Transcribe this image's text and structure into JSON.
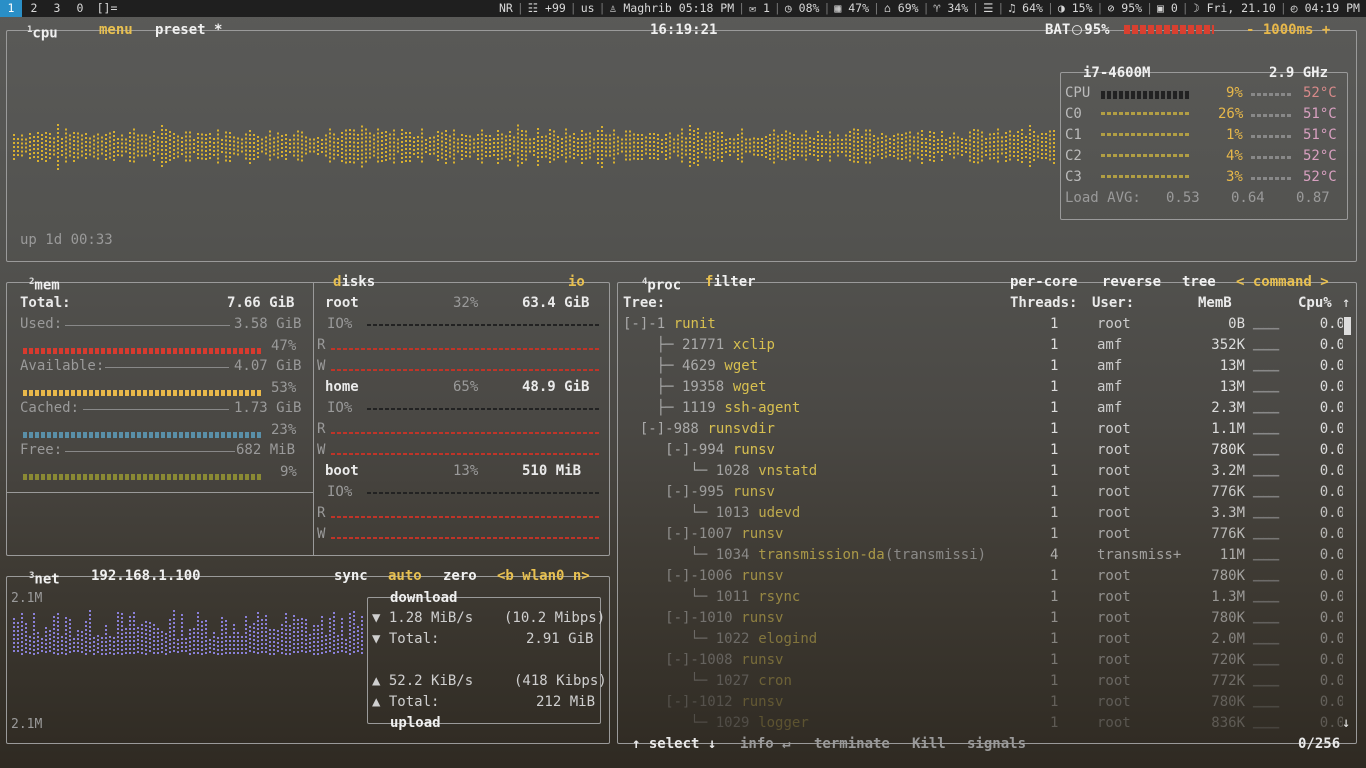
{
  "topbar": {
    "workspaces": [
      "1",
      "2",
      "3",
      "0",
      "[]="
    ],
    "active": 0,
    "status": [
      "NR",
      "|",
      "☷ +99",
      "|",
      "us",
      "|",
      "♙ Maghrib 05:18 PM",
      "|",
      "✉ 1",
      "|",
      "◷ 08%",
      "|",
      "▦ 47%",
      "|",
      "⌂ 69%",
      "|",
      "♈ 34%",
      "|",
      "☰",
      "|",
      "♫ 64%",
      "|",
      "◑ 15%",
      "|",
      "⊘ 95%",
      "|",
      "▣ 0",
      "|",
      "☽ Fri, 21.10",
      "|",
      "◴ 04:19 PM"
    ]
  },
  "cpu": {
    "title_num": "1",
    "title": "cpu",
    "menu": "menu",
    "preset": "preset *",
    "clock": "16:19:21",
    "bat_label": "BAT",
    "bat_pct": "95%",
    "interval": "- 1000ms +",
    "uptime": "up 1d 00:33",
    "model": "i7-4600M",
    "freq": "2.9 GHz",
    "cores": [
      {
        "name": "CPU",
        "pct": "9%",
        "temp": "52°C"
      },
      {
        "name": "C0",
        "pct": "26%",
        "temp": "51°C"
      },
      {
        "name": "C1",
        "pct": "1%",
        "temp": "51°C"
      },
      {
        "name": "C2",
        "pct": "4%",
        "temp": "52°C"
      },
      {
        "name": "C3",
        "pct": "3%",
        "temp": "52°C"
      }
    ],
    "load_label": "Load AVG:",
    "load": [
      "0.53",
      "0.64",
      "0.87"
    ]
  },
  "mem": {
    "title_num": "2",
    "title": "mem",
    "total_label": "Total:",
    "total": "7.66 GiB",
    "used_label": "Used:",
    "used": "3.58 GiB",
    "used_pct": "47%",
    "avail_label": "Available:",
    "avail": "4.07 GiB",
    "avail_pct": "53%",
    "cached_label": "Cached:",
    "cached": "1.73 GiB",
    "cached_pct": "23%",
    "free_label": "Free:",
    "free": "682 MiB",
    "free_pct": "9%",
    "colors": {
      "used": "#d83a2e",
      "avail": "#e8b84a",
      "cached": "#5a8fa8",
      "free": "#9a9a3a"
    }
  },
  "disks": {
    "title": "disks",
    "io": "io",
    "items": [
      {
        "name": "root",
        "pct": "32%",
        "size": "63.4 GiB"
      },
      {
        "name": "home",
        "pct": "65%",
        "size": "48.9 GiB"
      },
      {
        "name": "boot",
        "pct": "13%",
        "size": "510 MiB"
      }
    ],
    "io_label": "IO%",
    "r_label": "R",
    "w_label": "W"
  },
  "net": {
    "title_num": "3",
    "title": "net",
    "ip": "192.168.1.100",
    "sync": "sync",
    "auto": "auto",
    "zero": "zero",
    "iface": "<b wlan0 n>",
    "scale_top": "2.1M",
    "scale_bottom": "2.1M",
    "download_title": "download",
    "down_rate": "1.28 MiB/s",
    "down_bits": "(10.2 Mibps)",
    "down_total_label": "Total:",
    "down_total": "2.91 GiB",
    "up_rate": "52.2 KiB/s",
    "up_bits": "(418 Kibps)",
    "up_total_label": "Total:",
    "up_total": "212 MiB",
    "upload_title": "upload"
  },
  "proc": {
    "title_num": "4",
    "title": "proc",
    "filter": "filter",
    "per_core": "per-core",
    "reverse": "reverse",
    "tree": "tree",
    "sort": "< command >",
    "headers": {
      "tree": "Tree:",
      "threads": "Threads:",
      "user": "User:",
      "mem": "MemB",
      "cpu": "Cpu%"
    },
    "rows": [
      {
        "prefix": "[-]-1 ",
        "name": "runit",
        "args": "",
        "threads": "1",
        "user": "root",
        "mem": "0B",
        "cpu": "0.0"
      },
      {
        "prefix": "    ├─ 21771 ",
        "name": "xclip",
        "args": "",
        "threads": "1",
        "user": "amf",
        "mem": "352K",
        "cpu": "0.0"
      },
      {
        "prefix": "    ├─ 4629 ",
        "name": "wget",
        "args": "",
        "threads": "1",
        "user": "amf",
        "mem": "13M",
        "cpu": "0.0"
      },
      {
        "prefix": "    ├─ 19358 ",
        "name": "wget",
        "args": "",
        "threads": "1",
        "user": "amf",
        "mem": "13M",
        "cpu": "0.0"
      },
      {
        "prefix": "    ├─ 1119 ",
        "name": "ssh-agent",
        "args": "",
        "threads": "1",
        "user": "amf",
        "mem": "2.3M",
        "cpu": "0.0"
      },
      {
        "prefix": "  [-]-988 ",
        "name": "runsvdir",
        "args": "",
        "threads": "1",
        "user": "root",
        "mem": "1.1M",
        "cpu": "0.0"
      },
      {
        "prefix": "     [-]-994 ",
        "name": "runsv",
        "args": "",
        "threads": "1",
        "user": "root",
        "mem": "780K",
        "cpu": "0.0"
      },
      {
        "prefix": "        └─ 1028 ",
        "name": "vnstatd",
        "args": "",
        "threads": "1",
        "user": "root",
        "mem": "3.2M",
        "cpu": "0.0"
      },
      {
        "prefix": "     [-]-995 ",
        "name": "runsv",
        "args": "",
        "threads": "1",
        "user": "root",
        "mem": "776K",
        "cpu": "0.0"
      },
      {
        "prefix": "        └─ 1013 ",
        "name": "udevd",
        "args": "",
        "threads": "1",
        "user": "root",
        "mem": "3.3M",
        "cpu": "0.0"
      },
      {
        "prefix": "     [-]-1007 ",
        "name": "runsv",
        "args": "",
        "threads": "1",
        "user": "root",
        "mem": "776K",
        "cpu": "0.0"
      },
      {
        "prefix": "        └─ 1034 ",
        "name": "transmission-da",
        "args": " (transmissi)",
        "threads": "4",
        "user": "transmiss+",
        "mem": "11M",
        "cpu": "0.0"
      },
      {
        "prefix": "     [-]-1006 ",
        "name": "runsv",
        "args": "",
        "threads": "1",
        "user": "root",
        "mem": "780K",
        "cpu": "0.0"
      },
      {
        "prefix": "        └─ 1011 ",
        "name": "rsync",
        "args": "",
        "threads": "1",
        "user": "root",
        "mem": "1.3M",
        "cpu": "0.0"
      },
      {
        "prefix": "     [-]-1010 ",
        "name": "runsv",
        "args": "",
        "threads": "1",
        "user": "root",
        "mem": "780K",
        "cpu": "0.0"
      },
      {
        "prefix": "        └─ 1022 ",
        "name": "elogind",
        "args": "",
        "threads": "1",
        "user": "root",
        "mem": "2.0M",
        "cpu": "0.0"
      },
      {
        "prefix": "     [-]-1008 ",
        "name": "runsv",
        "args": "",
        "threads": "1",
        "user": "root",
        "mem": "720K",
        "cpu": "0.0"
      },
      {
        "prefix": "        └─ 1027 ",
        "name": "cron",
        "args": "",
        "threads": "1",
        "user": "root",
        "mem": "772K",
        "cpu": "0.0"
      },
      {
        "prefix": "     [-]-1012 ",
        "name": "runsv",
        "args": "",
        "threads": "1",
        "user": "root",
        "mem": "780K",
        "cpu": "0.0"
      },
      {
        "prefix": "        └─ 1029 ",
        "name": "logger",
        "args": "",
        "threads": "1",
        "user": "root",
        "mem": "836K",
        "cpu": "0.0"
      }
    ],
    "footer_select": "↑ select ↓",
    "footer_info": "info ↵",
    "footer_terminate": "terminate",
    "footer_kill": "Kill",
    "footer_signals": "signals",
    "count": "0/256"
  }
}
